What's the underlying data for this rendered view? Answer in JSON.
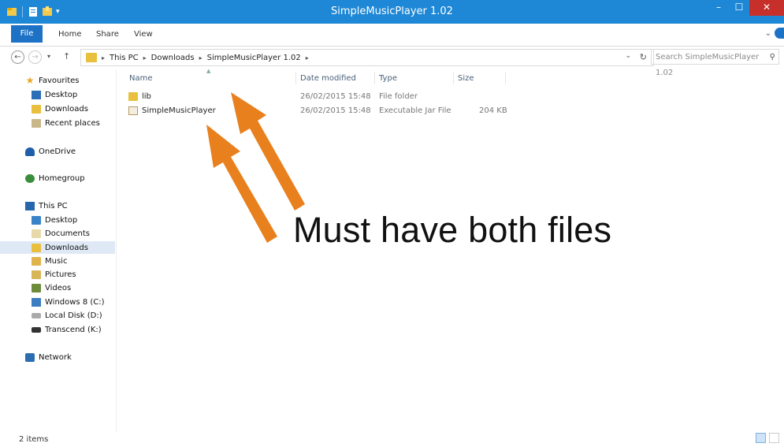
{
  "window": {
    "title": "SimpleMusicPlayer 1.02",
    "controls": {
      "minimize": "–",
      "maximize": "☐",
      "close": "✕"
    }
  },
  "ribbon": {
    "tabs": [
      "File",
      "Home",
      "Share",
      "View"
    ]
  },
  "address": {
    "crumbs": [
      "This PC",
      "Downloads",
      "SimpleMusicPlayer 1.02"
    ]
  },
  "search": {
    "placeholder": "Search SimpleMusicPlayer 1.02"
  },
  "nav": {
    "favourites": {
      "label": "Favourites",
      "items": [
        "Desktop",
        "Downloads",
        "Recent places"
      ]
    },
    "onedrive": "OneDrive",
    "homegroup": "Homegroup",
    "thispc": {
      "label": "This PC",
      "items": [
        "Desktop",
        "Documents",
        "Downloads",
        "Music",
        "Pictures",
        "Videos",
        "Windows 8 (C:)",
        "Local Disk (D:)",
        "Transcend (K:)"
      ]
    },
    "network": "Network"
  },
  "columns": [
    "Name",
    "Date modified",
    "Type",
    "Size"
  ],
  "files": [
    {
      "name": "lib",
      "date": "26/02/2015 15:48",
      "type": "File folder",
      "size": "",
      "icon": "folder-icon"
    },
    {
      "name": "SimpleMusicPlayer",
      "date": "26/02/2015 15:48",
      "type": "Executable Jar File",
      "size": "204 KB",
      "icon": "jar-icon"
    }
  ],
  "annotation": {
    "text": "Must have both files",
    "arrow_color": "#e8801e"
  },
  "status": {
    "count": "2 items"
  },
  "colors": {
    "titlebar": "#1e88d6",
    "file_tab": "#1e72c6",
    "close": "#c7302a"
  }
}
